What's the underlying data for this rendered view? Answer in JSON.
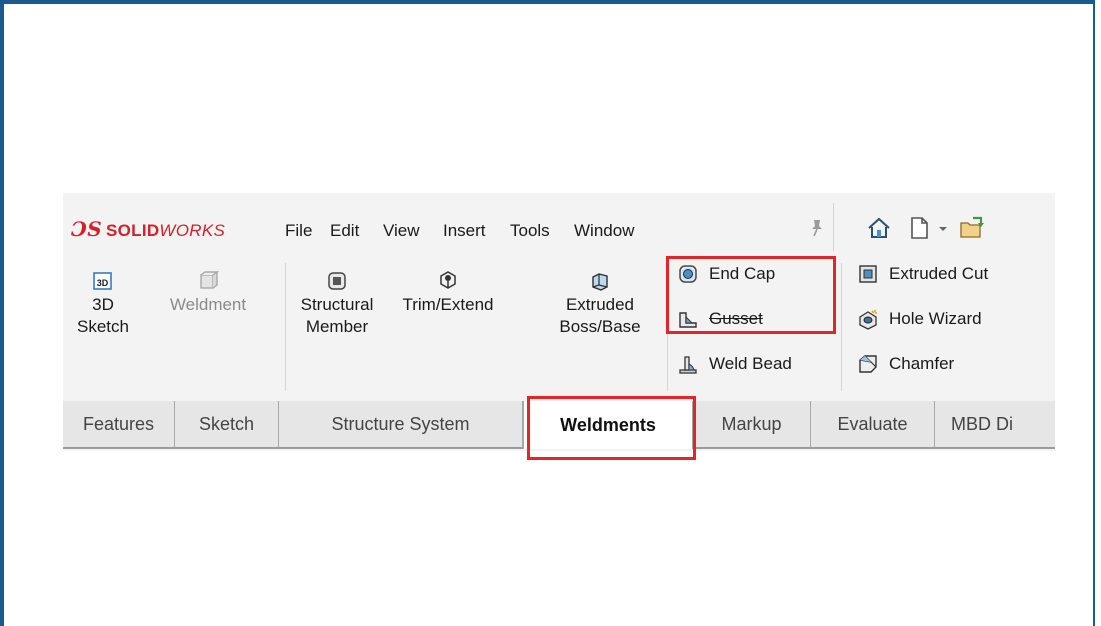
{
  "app": {
    "logo_ds": "ƆS",
    "logo_solid": "SOLID",
    "logo_works": "WORKS"
  },
  "menu": [
    "File",
    "Edit",
    "View",
    "Insert",
    "Tools",
    "Window"
  ],
  "ribbon": {
    "sketch3d": {
      "line1": "3D",
      "line2": "Sketch",
      "icon_text": "3D"
    },
    "weldment": {
      "line1": "Weldment"
    },
    "structural": {
      "line1": "Structural",
      "line2": "Member"
    },
    "trim": {
      "line1": "Trim/Extend"
    },
    "extruded": {
      "line1": "Extruded",
      "line2": "Boss/Base"
    },
    "end_cap": "End Cap",
    "gusset": "Gusset",
    "weld_bead": "Weld Bead",
    "extruded_cut": "Extruded Cut",
    "hole_wizard": "Hole Wizard",
    "chamfer": "Chamfer"
  },
  "tabs": [
    "Features",
    "Sketch",
    "Structure System",
    "Weldments",
    "Markup",
    "Evaluate",
    "MBD Di"
  ],
  "active_tab": "Weldments",
  "colors": {
    "frame": "#1b5a8e",
    "highlight": "#e1252a",
    "brand": "#d1222b"
  }
}
